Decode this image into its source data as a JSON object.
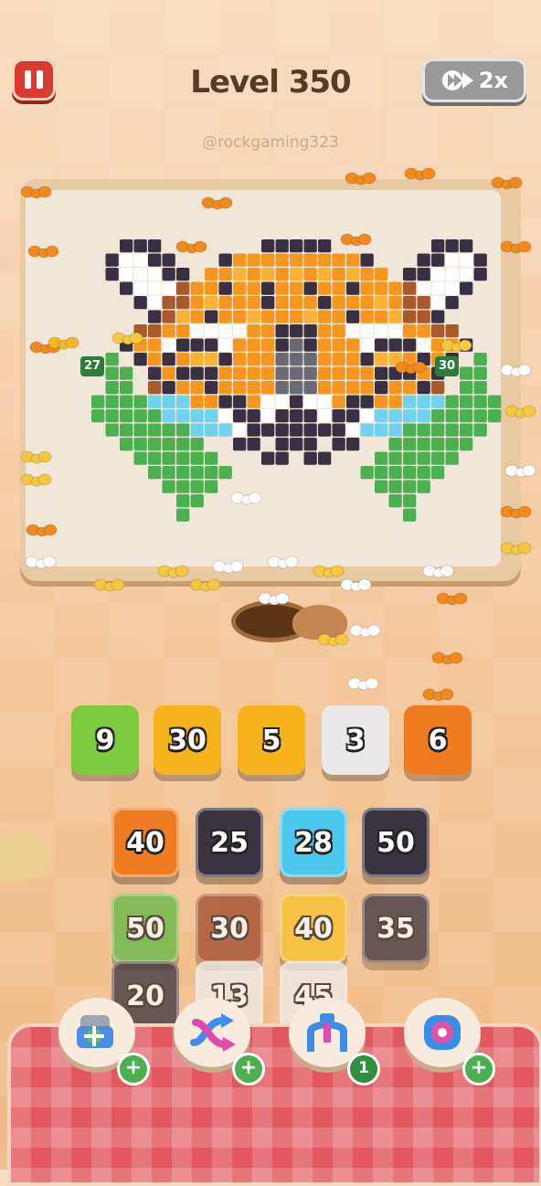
{
  "header": {
    "level_label": "Level 350",
    "speed_label": "2x",
    "watermark": "@rockgaming323"
  },
  "board": {
    "left_counter": "27",
    "right_counter": "30"
  },
  "queue": [
    {
      "value": "9",
      "color": "#7ccb3e"
    },
    {
      "value": "30",
      "color": "#f7b31b"
    },
    {
      "value": "5",
      "color": "#f7b31b"
    },
    {
      "value": "3",
      "color": "#e9e9e9"
    },
    {
      "value": "6",
      "color": "#f07c22"
    }
  ],
  "grid": [
    {
      "value": "40",
      "color": "#f07c22"
    },
    {
      "value": "25",
      "color": "#3a3340"
    },
    {
      "value": "28",
      "color": "#4cc8ee"
    },
    {
      "value": "50",
      "color": "#3a3340"
    },
    {
      "value": "50",
      "color": "#5dba46"
    },
    {
      "value": "30",
      "color": "#a04a2c"
    },
    {
      "value": "40",
      "color": "#f7c22a"
    },
    {
      "value": "35",
      "color": "#3a3340"
    },
    {
      "value": "20",
      "color": "#3a3340"
    },
    {
      "value": "13",
      "color": "#eeeeee"
    },
    {
      "value": "45",
      "color": "#eeeeee"
    }
  ],
  "powerups": [
    {
      "icon": "add-tray-icon",
      "badge": "+"
    },
    {
      "icon": "shuffle-arrows-icon",
      "badge": "+"
    },
    {
      "icon": "magnet-claw-icon",
      "badge": "1"
    },
    {
      "icon": "donut-icon",
      "badge": "+"
    }
  ]
}
